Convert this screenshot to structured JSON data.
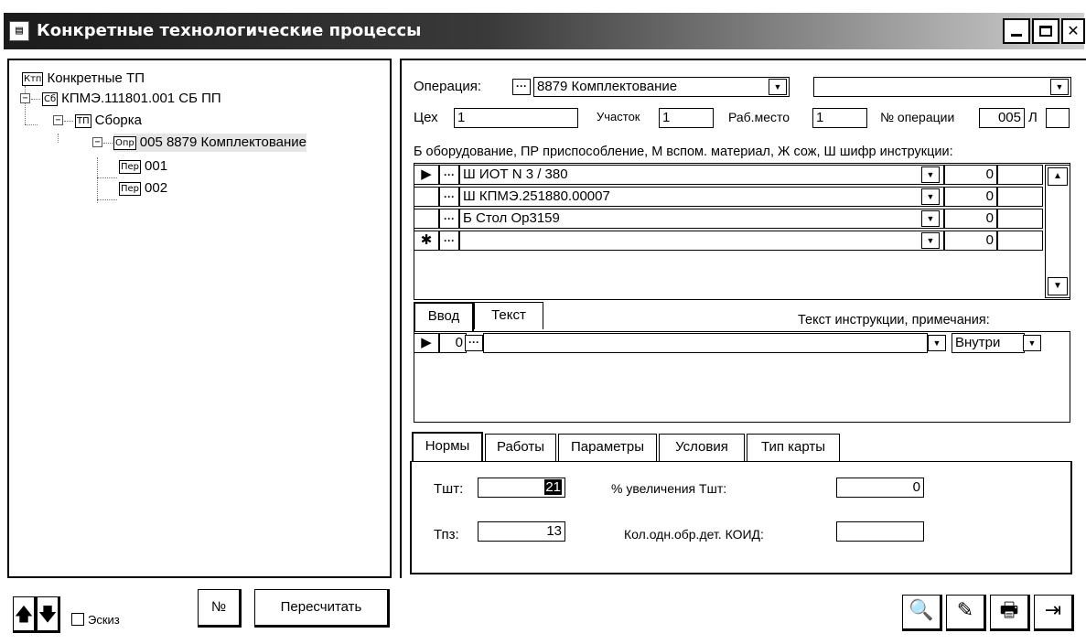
{
  "window": {
    "title": "Конкретные технологические процессы",
    "title_icon": "form-icon",
    "accent_color": "#1b1b1b"
  },
  "tree": {
    "root_icon": "Ктп",
    "root_label": "Конкретные ТП",
    "node1_icon": "Сб",
    "node1_label": "КПМЭ.111801.001 СБ ПП",
    "node2_icon": "ТП",
    "node2_label": "Сборка",
    "node3_icon": "Опр",
    "node3_label": "005 8879 Комплектование",
    "leaf1_icon": "Пер",
    "leaf1_label": "001",
    "leaf2_icon": "Пер",
    "leaf2_label": "002",
    "expand_sign": "−"
  },
  "operation": {
    "label": "Операция:",
    "value": "8879 Комплектование",
    "extra_value": "",
    "ceh_label": "Цех",
    "ceh_value": "1",
    "uchastok_label": "Участок",
    "uchastok_value": "1",
    "rabmesto_label": "Раб.место",
    "rabmesto_value": "1",
    "num_label": "№ операции",
    "num_value": "005",
    "l_label": "Л",
    "l_value": ""
  },
  "equipment": {
    "caption": "Б оборудование, ПР приспособление, М вспом. материал, Ж сож, Ш шифр инструкции:",
    "rows": [
      {
        "marker": "▶",
        "name": "Ш ИОТ N 3 / 380",
        "qty": "0"
      },
      {
        "marker": "",
        "name": "Ш КПМЭ.251880.00007",
        "qty": "0"
      },
      {
        "marker": "",
        "name": "Б Стол Ор3159",
        "qty": "0"
      },
      {
        "marker": "✱",
        "name": "",
        "qty": "0"
      }
    ]
  },
  "text_section": {
    "tab_input": "Ввод",
    "tab_text": "Текст",
    "caption": "Текст инструкции, примечания:",
    "row_marker": "▶",
    "row_num": "0",
    "row_text": "",
    "row_place": "Внутри"
  },
  "norms_tabs": [
    "Нормы",
    "Работы",
    "Параметры",
    "Условия",
    "Тип карты"
  ],
  "norms": {
    "tsht_label": "Тшт:",
    "tsht_value": "21",
    "tpz_label": "Тпз:",
    "tpz_value": "13",
    "increase_label": "% увеличения Тшт:",
    "increase_value": "0",
    "koid_label": "Кол.одн.обр.дет. КОИД:",
    "koid_value": ""
  },
  "bottom": {
    "up_icon": "arrow-up-icon",
    "down_icon": "arrow-down-icon",
    "up_glyph": "🡅",
    "down_glyph": "🡇",
    "sketch_label": "Эскиз",
    "num_button": "№",
    "recalc_button": "Пересчитать",
    "find_glyph": "🔍",
    "edit_glyph": "✎",
    "print_glyph": "🖶",
    "exit_glyph": "⇥"
  }
}
